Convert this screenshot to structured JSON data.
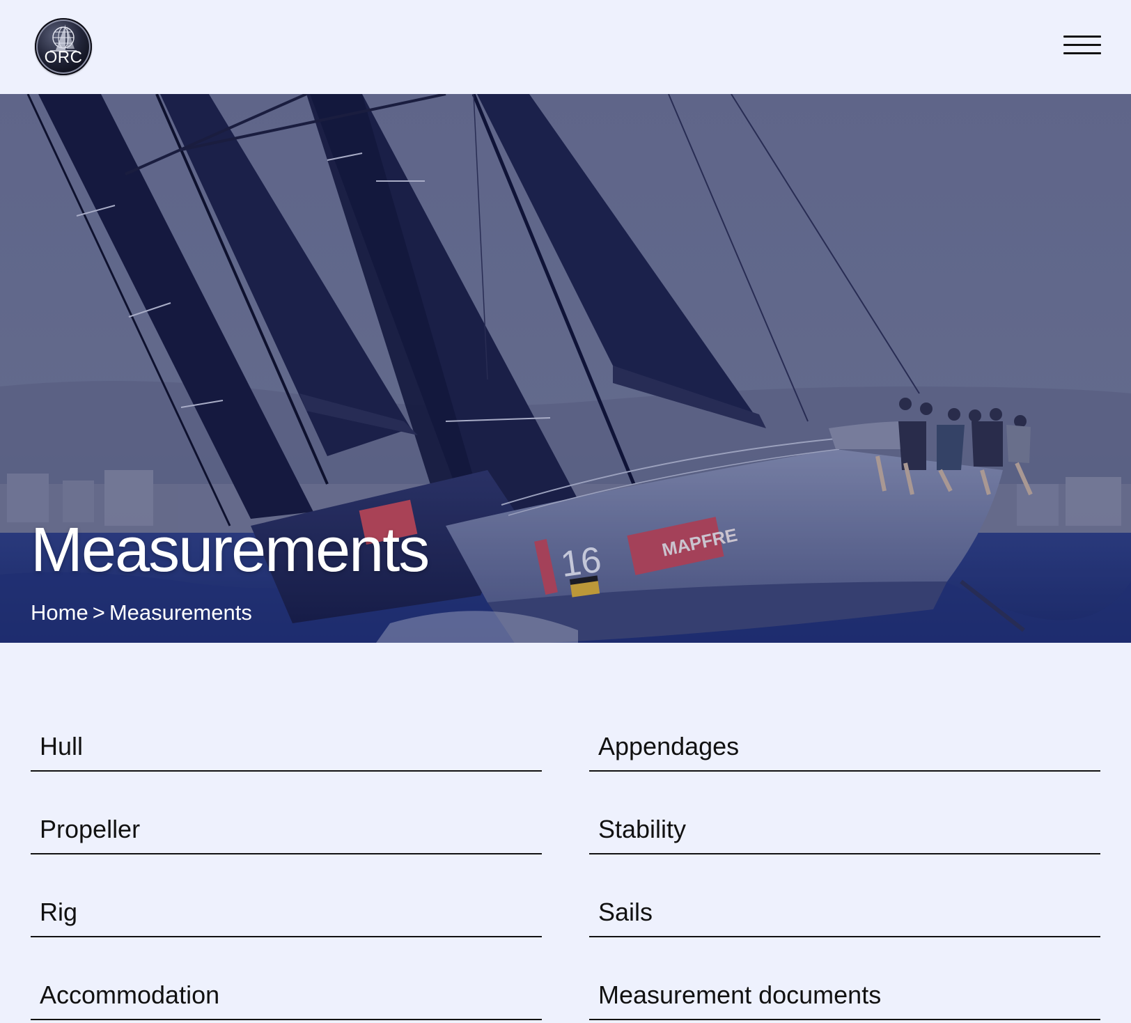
{
  "header": {
    "logo_text": "ORC",
    "menu_icon": "hamburger-menu-icon"
  },
  "hero": {
    "title": "Measurements",
    "breadcrumb": {
      "home": "Home",
      "separator": ">",
      "current": "Measurements"
    },
    "boat_numbers": [
      "16"
    ],
    "sponsor_text": "MAPFRE"
  },
  "links": {
    "left": [
      "Hull",
      "Propeller",
      "Rig",
      "Accommodation"
    ],
    "right": [
      "Appendages",
      "Stability",
      "Sails",
      "Measurement documents"
    ]
  },
  "colors": {
    "background": "#eef1fd",
    "text": "#111111",
    "hero_tint": "#1e245a",
    "hero_text": "#ffffff"
  }
}
